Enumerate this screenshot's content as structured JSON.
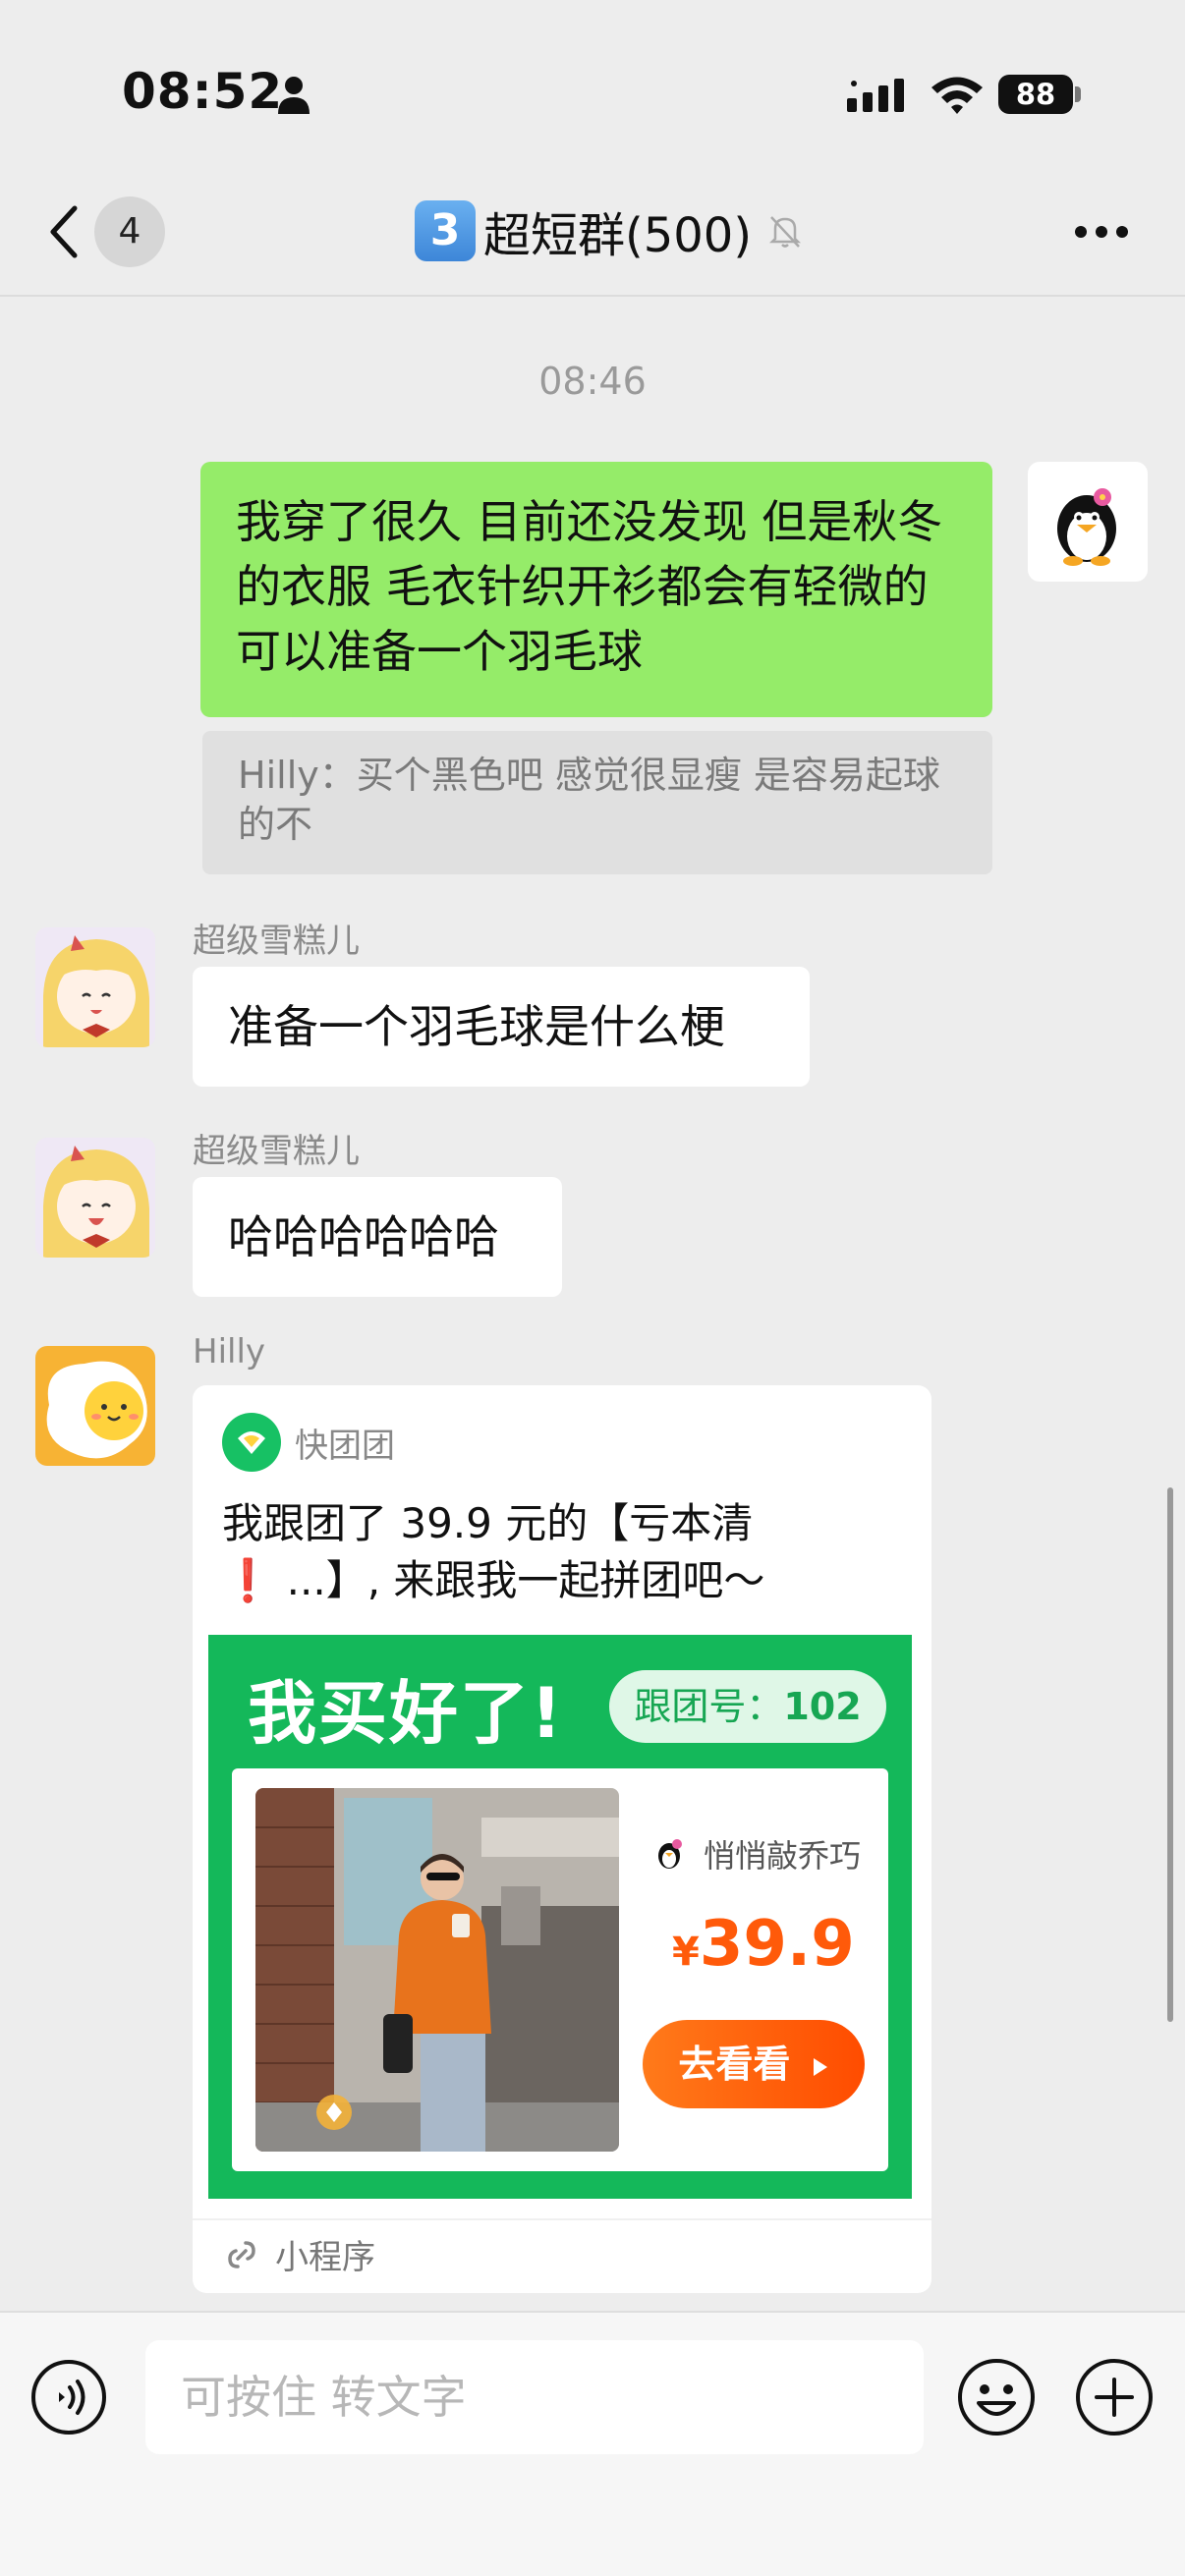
{
  "status_bar": {
    "time": "08:52",
    "battery": "88"
  },
  "nav": {
    "badge": "4",
    "title_emoji_number": "3",
    "title": "超短群(500)"
  },
  "chat": {
    "timestamp": "08:46",
    "messages": [
      {
        "side": "right",
        "text": "我穿了很久 目前还没发现 但是秋冬的衣服 毛衣针织开衫都会有轻微的 可以准备一个羽毛球"
      },
      {
        "side": "left",
        "sender": "超级雪糕儿",
        "text": "准备一个羽毛球是什么梗"
      },
      {
        "side": "left",
        "sender": "超级雪糕儿",
        "text": "哈哈哈哈哈哈"
      },
      {
        "side": "left",
        "sender": "Hilly"
      }
    ],
    "quote": "Hilly：买个黑色吧 感觉很显瘦 是容易起球的不"
  },
  "card": {
    "app_name": "快团团",
    "description_line1": "我跟团了 39.9 元的【亏本清",
    "description_line2": "❗ ...】, 来跟我一起拼团吧～",
    "promo_title": "我买好了!",
    "group_label": "跟团号：",
    "group_number": "102",
    "seller": "悄悄敲乔巧",
    "price_symbol": "¥",
    "price": "39.9",
    "button": "去看看",
    "footer": "小程序"
  },
  "input": {
    "placeholder": "可按住 转文字"
  },
  "colors": {
    "accent_green": "#95ec69",
    "brand_green": "#14b85a",
    "price_orange": "#ff5a0a"
  }
}
